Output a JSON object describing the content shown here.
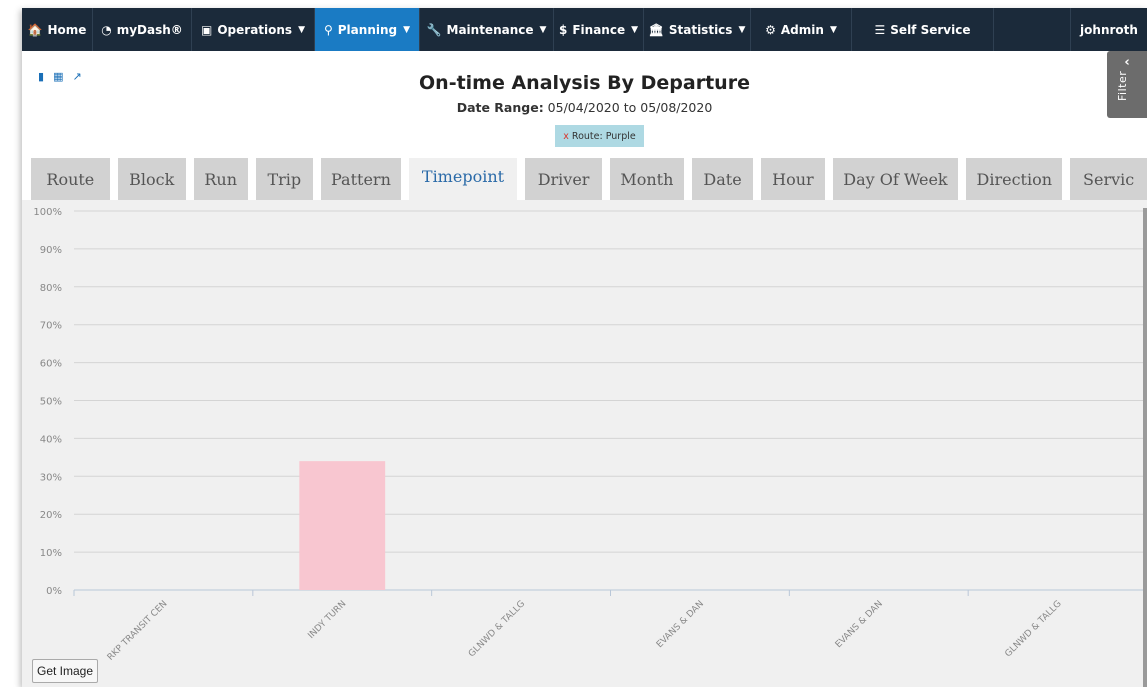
{
  "navbar": {
    "items": [
      {
        "label": "Home",
        "icon": "home-icon",
        "glyph": "🏠",
        "caret": false,
        "active": false
      },
      {
        "label": "myDash®",
        "icon": "dashboard-icon",
        "glyph": "◔",
        "caret": false,
        "active": false
      },
      {
        "label": "Operations",
        "icon": "bus-icon",
        "glyph": "▣",
        "caret": true,
        "active": false
      },
      {
        "label": "Planning",
        "icon": "map-marker-icon",
        "glyph": "⚲",
        "caret": true,
        "active": true
      },
      {
        "label": "Maintenance",
        "icon": "wrench-icon",
        "glyph": "🔧",
        "caret": true,
        "active": false
      },
      {
        "label": "Finance",
        "icon": "dollar-icon",
        "glyph": "$",
        "caret": true,
        "active": false
      },
      {
        "label": "Statistics",
        "icon": "bank-icon",
        "glyph": "🏛",
        "caret": true,
        "active": false
      },
      {
        "label": "Admin",
        "icon": "gears-icon",
        "glyph": "⚙",
        "caret": true,
        "active": false
      },
      {
        "label": "Self Service",
        "icon": "database-icon",
        "glyph": "☰",
        "caret": false,
        "active": false
      }
    ],
    "user": "johnroth"
  },
  "toolbar_icons": [
    "bookmark-icon",
    "calendar-icon",
    "external-link-icon"
  ],
  "report": {
    "title": "On-time Analysis By Departure",
    "date_label": "Date Range:",
    "date_from": "05/04/2020",
    "date_to_word": "to",
    "date_to": "05/08/2020"
  },
  "route_filter_chip": {
    "remove": "x",
    "label": "Route: Purple"
  },
  "filter_tab": {
    "label": "Filter",
    "chevron": "‹"
  },
  "tabs": [
    {
      "label": "Route",
      "active": false
    },
    {
      "label": "Block",
      "active": false
    },
    {
      "label": "Run",
      "active": false
    },
    {
      "label": "Trip",
      "active": false
    },
    {
      "label": "Pattern",
      "active": false
    },
    {
      "label": "Timepoint",
      "active": true
    },
    {
      "label": "Driver",
      "active": false
    },
    {
      "label": "Month",
      "active": false
    },
    {
      "label": "Date",
      "active": false
    },
    {
      "label": "Hour",
      "active": false
    },
    {
      "label": "Day Of Week",
      "active": false
    },
    {
      "label": "Direction",
      "active": false
    },
    {
      "label": "Servic",
      "active": false
    }
  ],
  "get_image_label": "Get Image",
  "colors": {
    "navbar": "#1b2a3a",
    "active_nav": "#1a7bc4",
    "bar": "#f8c6d0",
    "chip": "#aed9e3"
  },
  "chart_data": {
    "type": "bar",
    "categories": [
      "RKP TRANSIT CEN",
      "INDY TURN",
      "GLNWD & TALLG",
      "EVANS & DAN",
      "EVANS & DAN",
      "GLNWD & TALLG"
    ],
    "values": [
      0,
      34,
      0,
      0,
      0,
      0
    ],
    "ylim": [
      0,
      100
    ],
    "yticks": [
      "0%",
      "10%",
      "20%",
      "30%",
      "40%",
      "50%",
      "60%",
      "70%",
      "80%",
      "90%",
      "100%"
    ],
    "grid": true,
    "color": "#f8c6d0"
  }
}
